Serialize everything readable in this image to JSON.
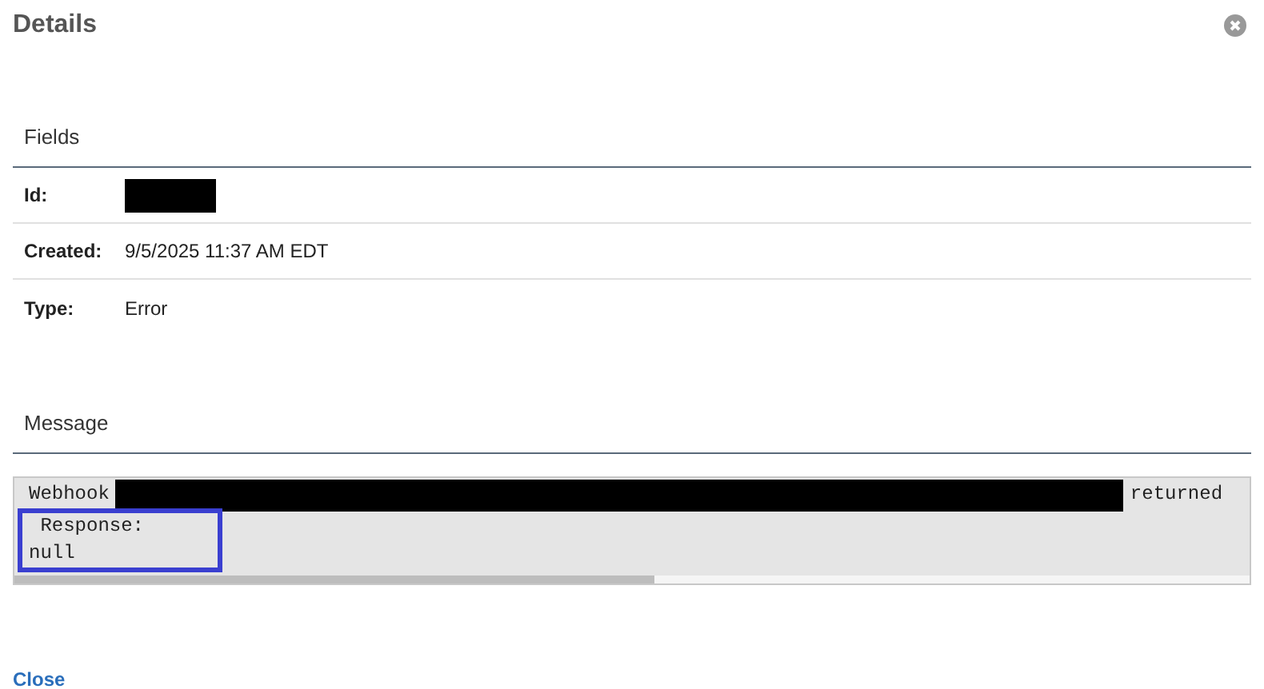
{
  "dialog": {
    "title": "Details"
  },
  "fields": {
    "heading": "Fields",
    "rows": [
      {
        "label": "Id:",
        "kind": "redacted"
      },
      {
        "label": "Created:",
        "kind": "text",
        "value": "9/5/2025 11:37 AM EDT"
      },
      {
        "label": "Type:",
        "kind": "text",
        "value": "Error"
      }
    ]
  },
  "message": {
    "heading": "Message",
    "lines": [
      {
        "highlighted": false,
        "parts": [
          {
            "kind": "text",
            "text": "Webhook"
          },
          {
            "kind": "redacted"
          },
          {
            "kind": "text",
            "text": "returned"
          }
        ]
      },
      {
        "highlighted": true,
        "parts": [
          {
            "kind": "text",
            "text": " Response:"
          }
        ]
      },
      {
        "highlighted": true,
        "parts": [
          {
            "kind": "text",
            "text": "null"
          }
        ]
      }
    ]
  },
  "close_link": "Close"
}
